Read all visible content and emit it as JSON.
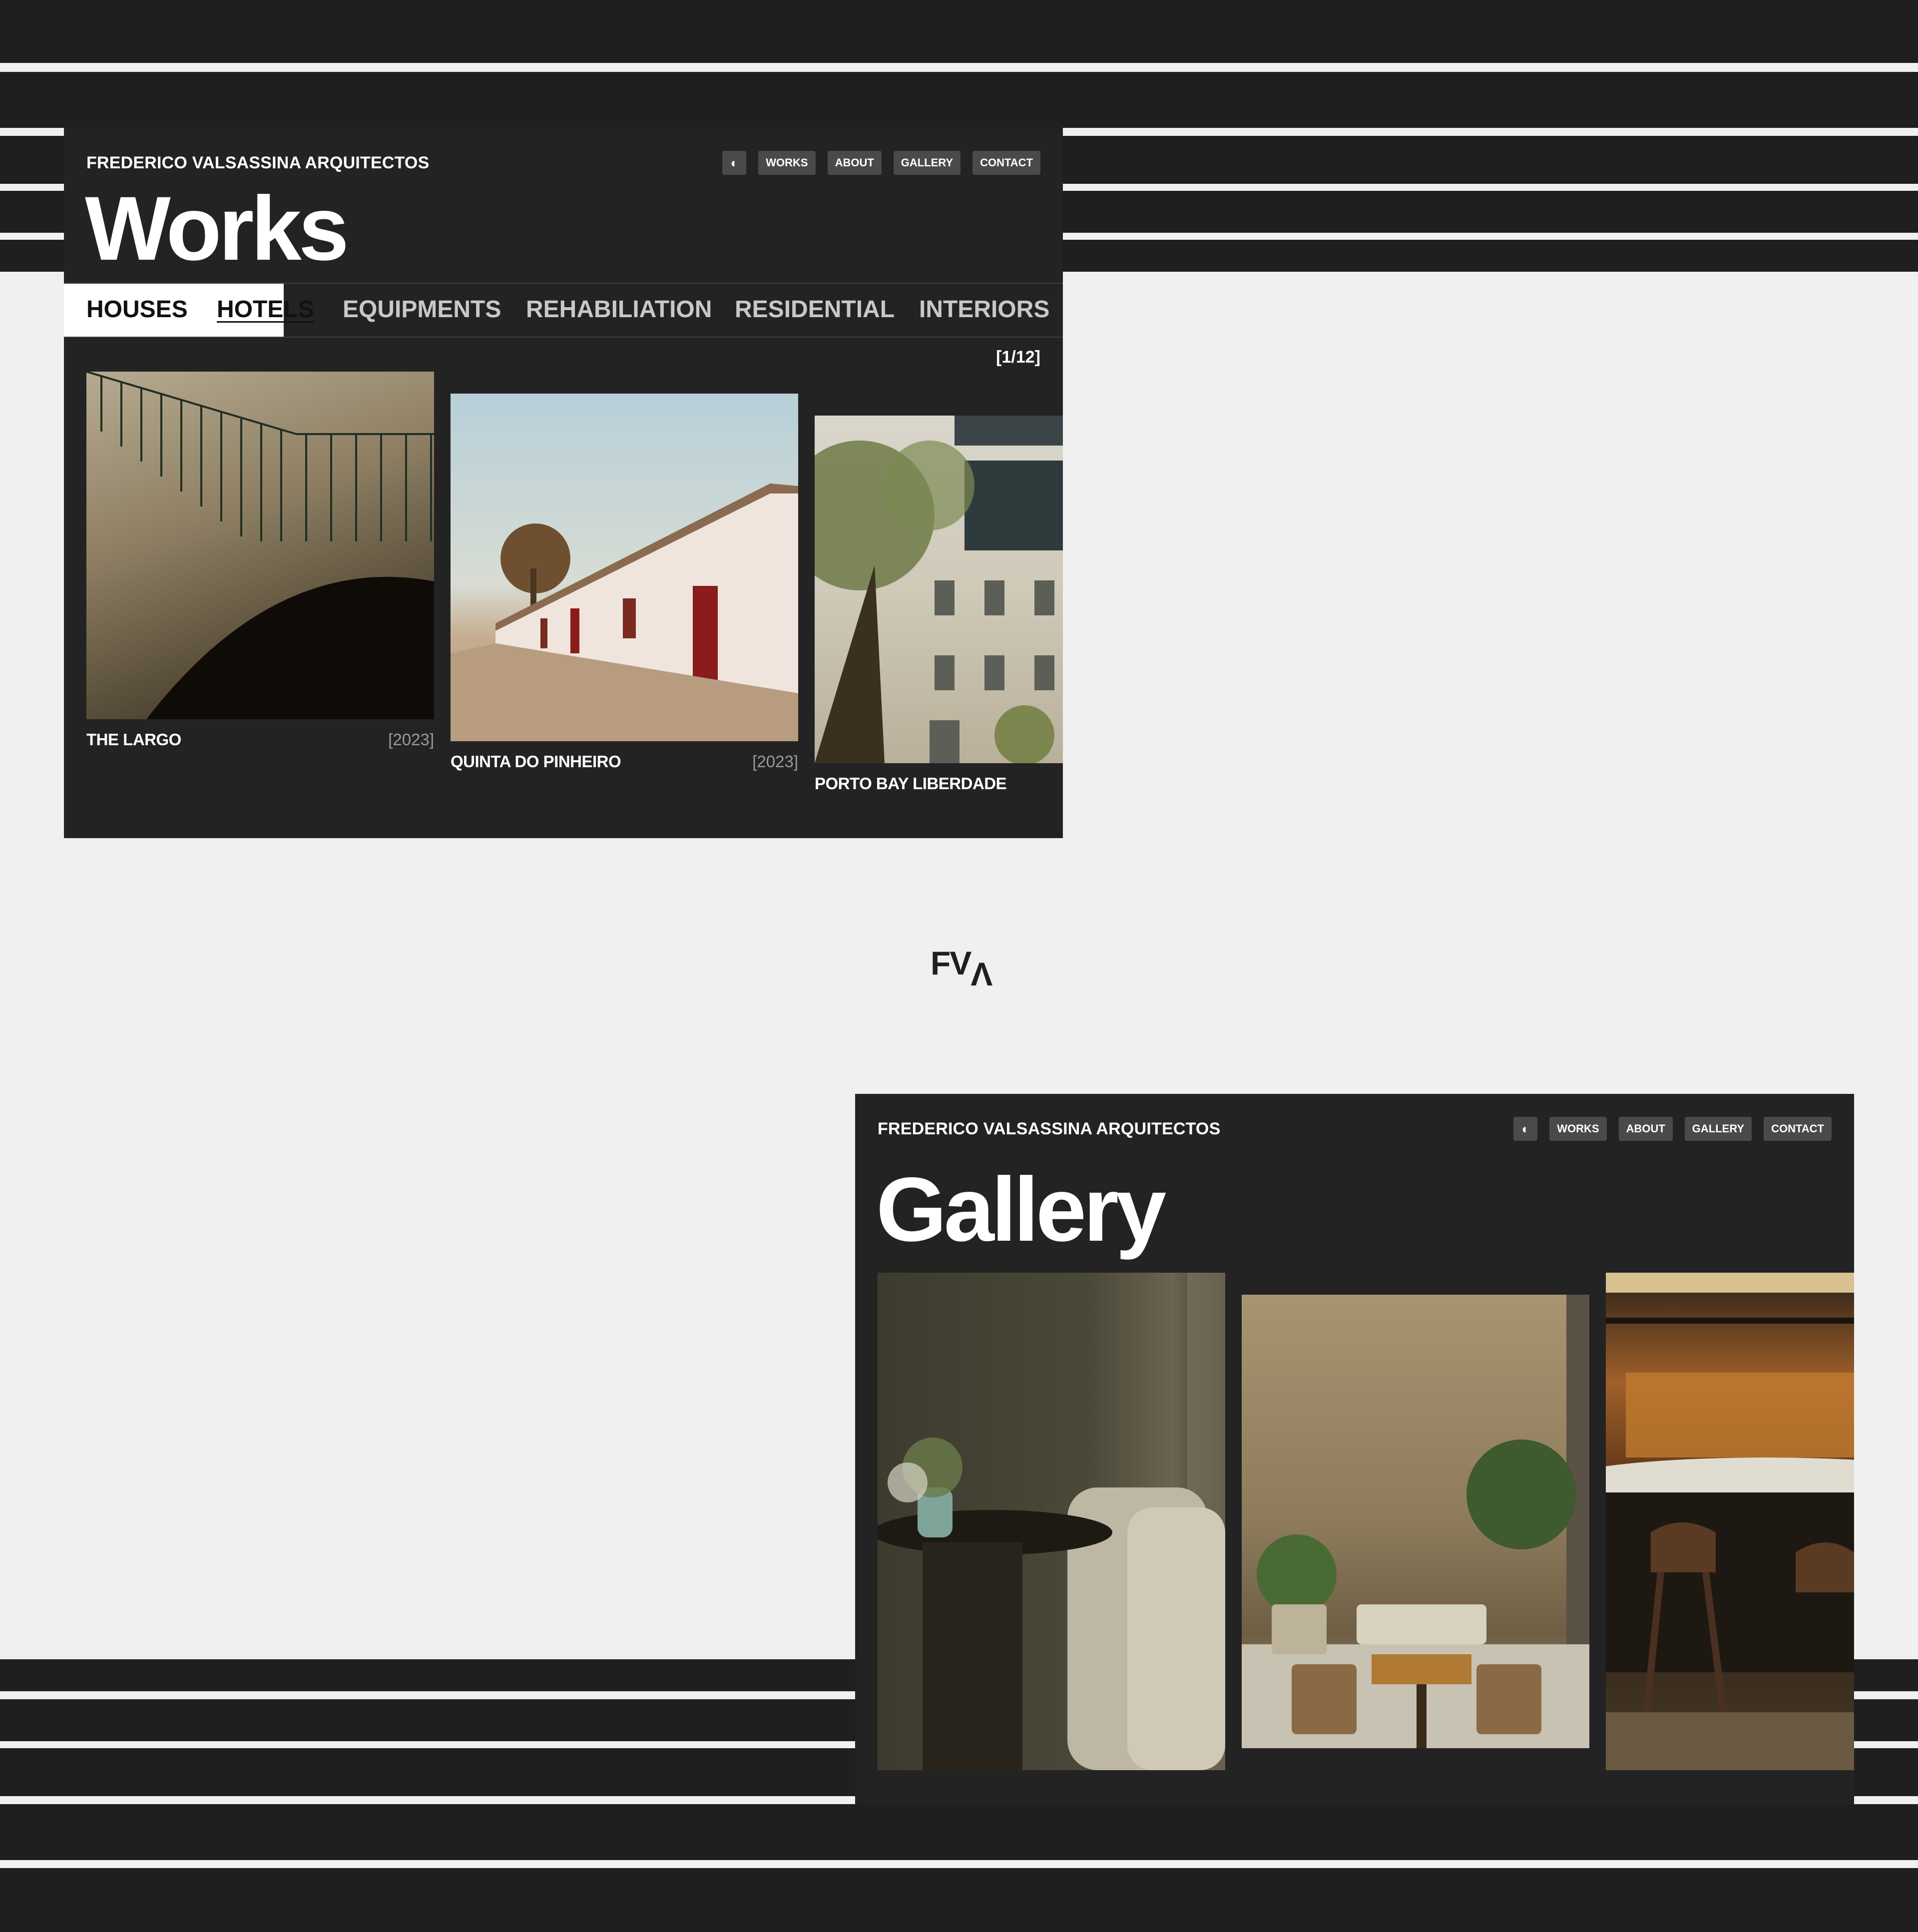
{
  "works_page": {
    "brand": "FREDERICO VALSASSINA ARQUITECTOS",
    "nav": {
      "theme_icon": "◐",
      "works": "WORKS",
      "about": "ABOUT",
      "gallery": "GALLERY",
      "contact": "CONTACT"
    },
    "title": "Works",
    "tabs": [
      {
        "label": "HOUSES"
      },
      {
        "label": "HOTELS"
      },
      {
        "label": "EQUIPMENTS"
      },
      {
        "label": "REHABILIATION"
      },
      {
        "label": "RESIDENTIAL"
      },
      {
        "label": "INTERIORS"
      }
    ],
    "counter": "[1/12]",
    "projects": [
      {
        "name": "THE LARGO",
        "year": "[2023]"
      },
      {
        "name": "QUINTA DO PINHEIRO",
        "year": "[2023]"
      },
      {
        "name": "PORTO BAY LIBERDADE",
        "year": ""
      }
    ]
  },
  "logo": {
    "letters": "FV",
    "mark": "Λ"
  },
  "gallery_page": {
    "brand": "FREDERICO VALSASSINA ARQUITECTOS",
    "nav": {
      "theme_icon": "◐",
      "works": "WORKS",
      "about": "ABOUT",
      "gallery": "GALLERY",
      "contact": "CONTACT"
    },
    "title": "Gallery"
  },
  "colors": {
    "panel": "#232323",
    "background": "#f0f0f0",
    "stripe": "#1f1f1f",
    "button": "#4a4a4a"
  }
}
